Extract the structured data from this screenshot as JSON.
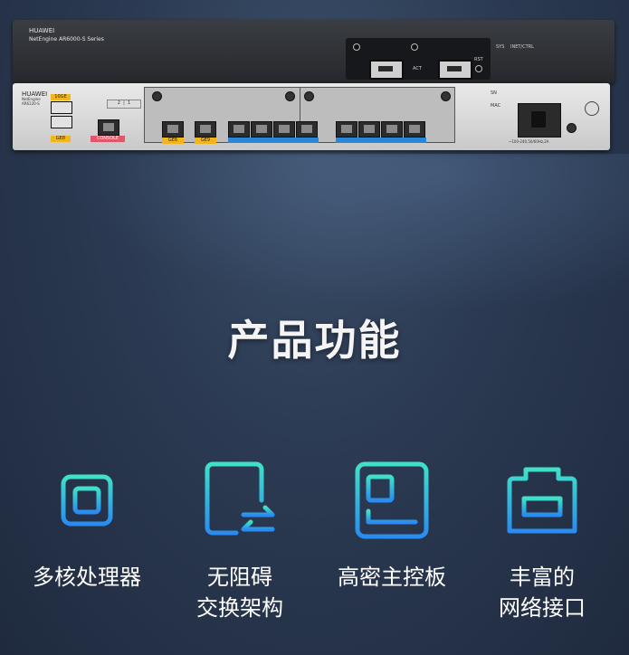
{
  "device": {
    "brand": "HUAWEI",
    "series": "NetEngine AR6000-S Series",
    "front_brand": "HUAWEI",
    "front_model_line1": "NetEngine",
    "front_model_line2": "AR6120-S",
    "top_labels": {
      "sys": "SYS",
      "inet": "INET/CTRL",
      "act": "ACT",
      "rst": "RST"
    },
    "front_labels": {
      "sfp_10ge": "10GE",
      "ge8": "GE8",
      "console": "CONSOLE",
      "ge6": "GE6",
      "ge9": "GE9",
      "sn": "SN",
      "mac": "MAC",
      "power_rating": "~100-240,50/60Hz,2A"
    },
    "slot_nums": [
      "2",
      "1"
    ]
  },
  "title": "产品功能",
  "features": [
    {
      "icon": "processor-chip-icon",
      "line1": "多核处理器",
      "line2": ""
    },
    {
      "icon": "switching-arrows-icon",
      "line1": "无阻碍",
      "line2": "交换架构"
    },
    {
      "icon": "main-board-icon",
      "line1": "高密主控板",
      "line2": ""
    },
    {
      "icon": "network-port-icon",
      "line1": "丰富的",
      "line2": "网络接口"
    }
  ],
  "colors": {
    "icon_gradient_top": "#3fe0c8",
    "icon_gradient_bottom": "#2a8cf0"
  }
}
